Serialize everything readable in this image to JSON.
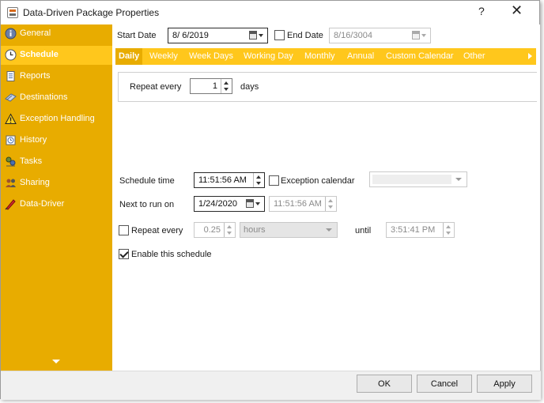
{
  "window": {
    "title": "Data-Driven Package Properties",
    "help_label": "?",
    "close_label": "✕"
  },
  "sidebar": {
    "items": [
      {
        "label": "General",
        "icon": "info-icon",
        "active": false
      },
      {
        "label": "Schedule",
        "icon": "clock-icon",
        "active": true
      },
      {
        "label": "Reports",
        "icon": "report-icon",
        "active": false
      },
      {
        "label": "Destinations",
        "icon": "destinations-icon",
        "active": false
      },
      {
        "label": "Exception Handling",
        "icon": "warning-icon",
        "active": false
      },
      {
        "label": "History",
        "icon": "history-icon",
        "active": false
      },
      {
        "label": "Tasks",
        "icon": "tasks-icon",
        "active": false
      },
      {
        "label": "Sharing",
        "icon": "sharing-icon",
        "active": false
      },
      {
        "label": "Data-Driver",
        "icon": "data-driver-icon",
        "active": false
      }
    ]
  },
  "dates": {
    "start_label": "Start Date",
    "start_value": "8/ 6/2019",
    "end_label": "End Date",
    "end_value": "8/16/3004",
    "end_checked": false
  },
  "tabs": [
    "Daily",
    "Weekly",
    "Week Days",
    "Working Day",
    "Monthly",
    "Annual",
    "Custom Calendar",
    "Other"
  ],
  "active_tab": "Daily",
  "daily": {
    "repeat_label": "Repeat every",
    "repeat_value": "1",
    "unit": "days"
  },
  "schedule": {
    "time_label": "Schedule time",
    "time_value": "11:51:56 AM",
    "exception_label": "Exception calendar",
    "exception_checked": false,
    "exception_value": "",
    "next_label": "Next to run on",
    "next_date": "1/24/2020",
    "next_time": "11:51:56 AM",
    "repeat_label": "Repeat every",
    "repeat_checked": false,
    "repeat_value": "0.25",
    "repeat_unit": "hours",
    "until_label": "until",
    "until_value": "3:51:41 PM",
    "enable_label": "Enable this schedule",
    "enable_checked": true
  },
  "footer": {
    "ok": "OK",
    "cancel": "Cancel",
    "apply": "Apply"
  },
  "colors": {
    "sidebar": "#e8ac00",
    "sidebar_active": "#ffc71c",
    "tabbar": "#ffc71c",
    "tab_active": "#e8ac00"
  }
}
